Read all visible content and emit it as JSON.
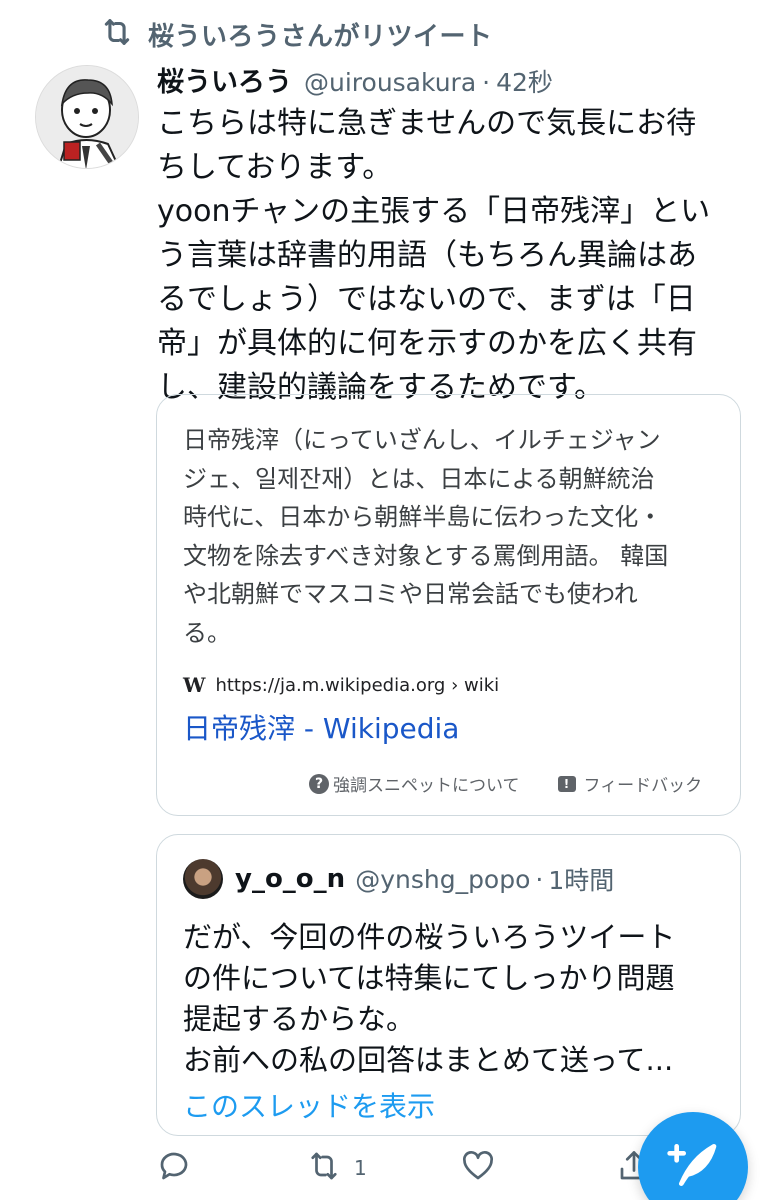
{
  "retweet_header": {
    "text": "桜ういろうさんがリツイート",
    "icon": "retweet-icon"
  },
  "tweet": {
    "display_name": "桜ういろう",
    "handle": "@uirousakura",
    "separator": "·",
    "time": "42秒",
    "body_lines": [
      "こちらは特に急ぎませんので気長にお待",
      "ちしております。",
      "yoonチャンの主張する「日帝残滓」とい",
      "う言葉は辞書的用語（もちろん異論はあ",
      "るでしょう）ではないので、まずは「日",
      "帝」が具体的に何を示すのかを広く共有",
      "し、建設的議論をするためです。"
    ]
  },
  "snippet_card": {
    "lines": [
      "日帝残滓（にっていざんし、イルチェジャン",
      "ジェ、일제잔재）とは、日本による朝鮮統治",
      "時代に、日本から朝鮮半島に伝わった文化・",
      "文物を除去すべき対象とする罵倒用語。 韓国",
      "や北朝鮮でマスコミや日常会話でも使われ",
      "る。"
    ],
    "source_logo": "W",
    "source_url": "https://ja.m.wikipedia.org › wiki",
    "link_title": "日帝残滓 - Wikipedia",
    "about_label": "強調スニペットについて",
    "feedback_label": "フィードバック"
  },
  "quoted_tweet": {
    "display_name": "y_o_o_n",
    "handle": "@ynshg_popo",
    "separator": "·",
    "time": "1時間",
    "body_lines": [
      "だが、今回の件の桜ういろうツイート",
      "の件については特集にてしっかり問題",
      "提起するからな。",
      "お前への私の回答はまとめて送って..."
    ],
    "show_thread": "このスレッドを表示"
  },
  "actions": {
    "reply_count": "",
    "retweet_count": "1",
    "like_count": "",
    "share_count": ""
  },
  "colors": {
    "accent": "#1d9bf0",
    "muted": "#536471",
    "text": "#0f1419",
    "border": "#cfd9de",
    "link": "#1a57c8"
  }
}
